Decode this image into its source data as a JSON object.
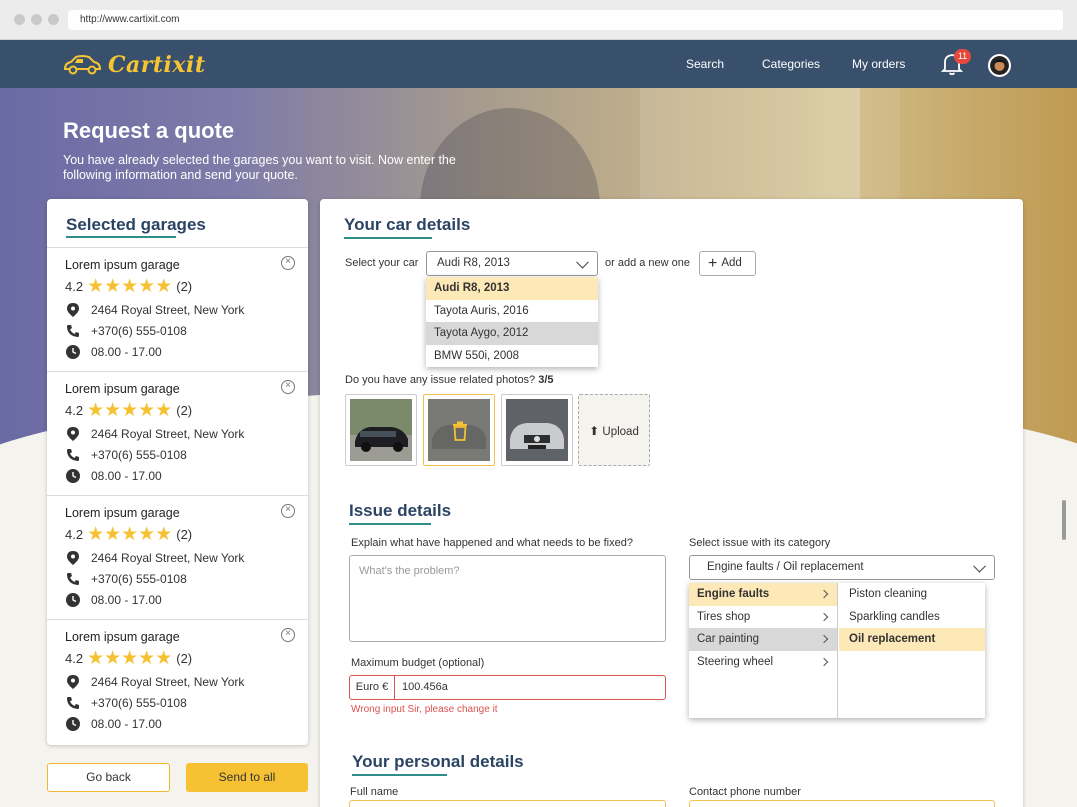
{
  "browser": {
    "url": "http://www.cartixit.com"
  },
  "nav": {
    "logo_text": "Cartixit",
    "links": [
      "Search",
      "Categories",
      "My orders"
    ],
    "notification_count": "11"
  },
  "hero": {
    "title": "Request a quote",
    "subtitle": "You have already selected the garages you want to visit. Now enter the following information and send your quote."
  },
  "garages_panel": {
    "title": "Selected garages",
    "garages": [
      {
        "name": "Lorem ipsum garage",
        "rating": "4.2",
        "stars": "★★★★★",
        "reviews": "(2)",
        "address": "2464 Royal Street, New York",
        "phone": "+370(6) 555-0108",
        "hours": "08.00 - 17.00"
      },
      {
        "name": "Lorem ipsum garage",
        "rating": "4.2",
        "stars": "★★★★★",
        "reviews": "(2)",
        "address": "2464 Royal Street, New York",
        "phone": "+370(6) 555-0108",
        "hours": "08.00 - 17.00"
      },
      {
        "name": "Lorem ipsum garage",
        "rating": "4.2",
        "stars": "★★★★★",
        "reviews": "(2)",
        "address": "2464 Royal Street, New York",
        "phone": "+370(6) 555-0108",
        "hours": "08.00 - 17.00"
      },
      {
        "name": "Lorem ipsum garage",
        "rating": "4.2",
        "stars": "★★★★★",
        "reviews": "(2)",
        "address": "2464 Royal Street, New York",
        "phone": "+370(6) 555-0108",
        "hours": "08.00 - 17.00"
      }
    ],
    "back_label": "Go back",
    "send_label": "Send to all"
  },
  "car_details": {
    "title": "Your car details",
    "select_label": "Select your car",
    "selected_car": "Audi R8, 2013",
    "add_new_label": "or add a new one",
    "add_button": "Add",
    "car_options": [
      "Audi R8, 2013",
      "Tayota Auris, 2016",
      "Tayota Aygo, 2012",
      "BMW 550i, 2008"
    ],
    "photos_question": "Do you have any issue related photos?",
    "photos_count": "3/5",
    "upload_label": "Upload"
  },
  "issue_details": {
    "title": "Issue details",
    "explain_label": "Explain what have happened and what needs to be fixed?",
    "explain_placeholder": "What's the problem?",
    "category_label": "Select issue with its category",
    "category_value": "Engine faults / Oil replacement",
    "categories": [
      "Engine faults",
      "Tires shop",
      "Car painting",
      "Steering wheel"
    ],
    "subcategories": [
      "Piston cleaning",
      "Sparkling candles",
      "Oil replacement"
    ],
    "budget_label": "Maximum budget (optional)",
    "budget_currency": "Euro €",
    "budget_value": "100.456a",
    "budget_error": "Wrong input Sir, please change it"
  },
  "personal_details": {
    "title": "Your personal details",
    "full_name_label": "Full name",
    "phone_label": "Contact phone number"
  },
  "colors": {
    "nav": "#39506d",
    "accent": "#f6c233",
    "title": "#2c4463",
    "error": "#d9534f"
  }
}
